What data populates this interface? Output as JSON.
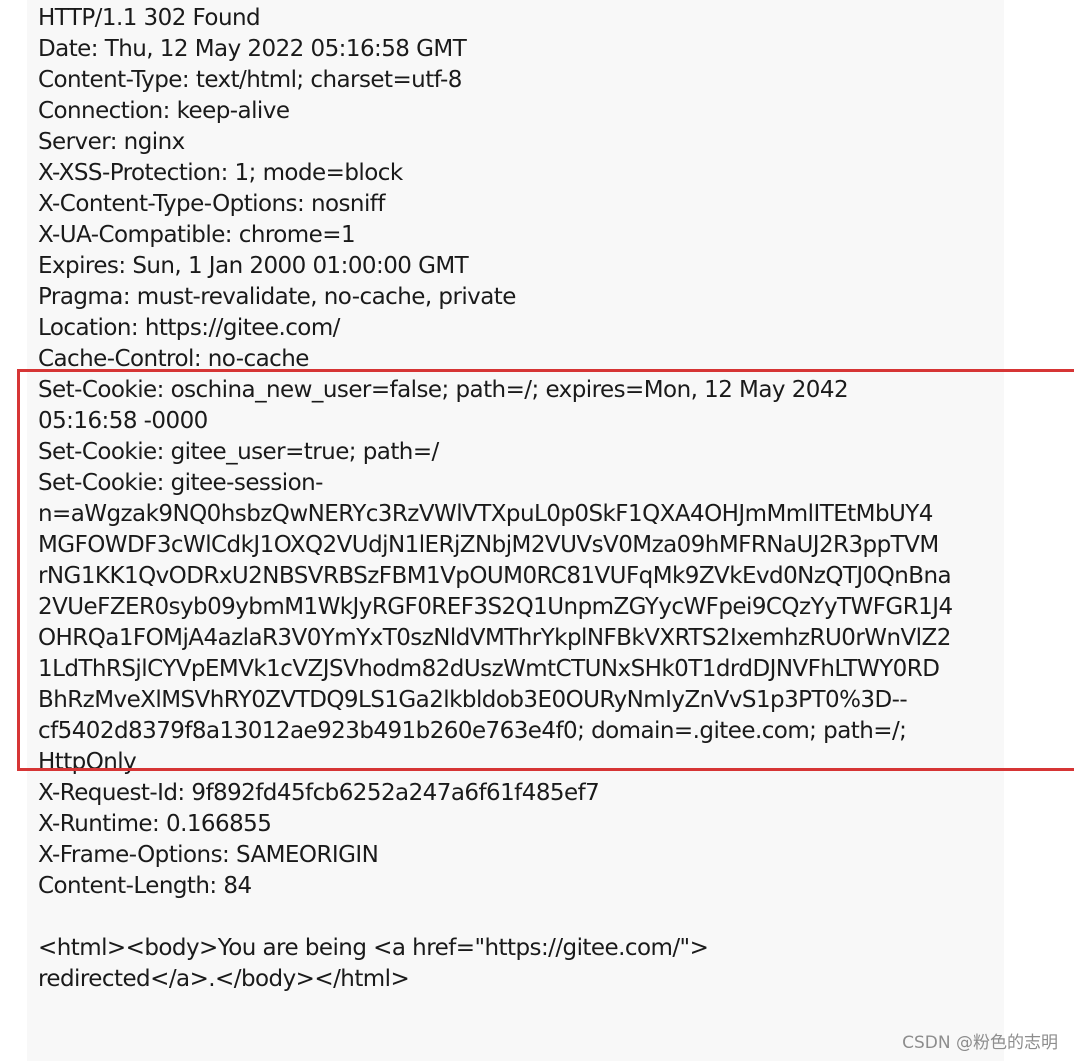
{
  "response": {
    "status_line": "HTTP/1.1 302 Found",
    "headers_before": [
      "Date: Thu, 12 May 2022 05:16:58 GMT",
      "Content-Type: text/html; charset=utf-8",
      "Connection: keep-alive",
      "Server: nginx",
      "X-XSS-Protection: 1; mode=block",
      "X-Content-Type-Options: nosniff",
      "X-UA-Compatible: chrome=1",
      "Expires: Sun, 1 Jan 2000 01:00:00 GMT",
      "Pragma: must-revalidate, no-cache, private",
      "Location: https://gitee.com/",
      "Cache-Control: no-cache"
    ],
    "set_cookie_lines": [
      "Set-Cookie: oschina_new_user=false; path=/; expires=Mon, 12 May 2042",
      "05:16:58 -0000",
      "Set-Cookie: gitee_user=true; path=/",
      "Set-Cookie: gitee-session-",
      "n=aWgzak9NQ0hsbzQwNERYc3RzVWlVTXpuL0p0SkF1QXA4OHJmMmlITEtMbUY4",
      "MGFOWDF3cWlCdkJ1OXQ2VUdjN1lERjZNbjM2VUVsV0Mza09hMFRNaUJ2R3ppTVM",
      "rNG1KK1QvODRxU2NBSVRBSzFBM1VpOUM0RC81VUFqMk9ZVkEvd0NzQTJ0QnBna",
      "2VUeFZER0syb09ybmM1WkJyRGF0REF3S2Q1UnpmZGYycWFpei9CQzYyTWFGR1J4",
      "OHRQa1FOMjA4azlaR3V0YmYxT0szNldVMThrYkplNFBkVXRTS2IxemhzRU0rWnVlZ2",
      "1LdThRSjlCYVpEMVk1cVZJSVhodm82dUszWmtCTUNxSHk0T1drdDJNVFhLTWY0RD",
      "BhRzMveXlMSVhRY0ZVTDQ9LS1Ga2lkbldob3E0OURyNmIyZnVvS1p3PT0%3D--",
      "cf5402d8379f8a13012ae923b491b260e763e4f0; domain=.gitee.com; path=/;",
      "HttpOnly"
    ],
    "headers_after": [
      "X-Request-Id: 9f892fd45fcb6252a247a6f61f485ef7",
      "X-Runtime: 0.166855",
      "X-Frame-Options: SAMEORIGIN",
      "Content-Length: 84"
    ],
    "body_lines": [
      "<html><body>You are being <a href=\"https://gitee.com/\">",
      "redirected</a>.</body></html>"
    ]
  },
  "watermark": "CSDN @粉色的志明",
  "colors": {
    "highlight_border": "#d63535",
    "panel_background": "#f8f8f8",
    "text": "#1a1a1a"
  }
}
